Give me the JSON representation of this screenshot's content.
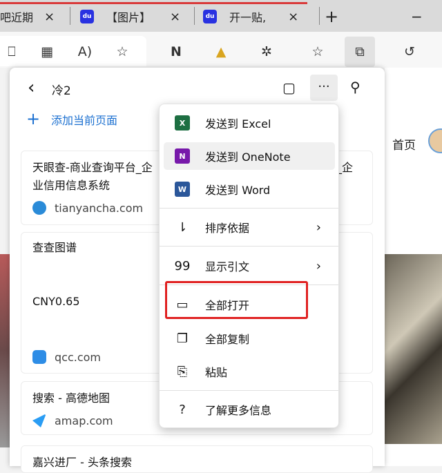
{
  "tabs": [
    {
      "label": "吧近期",
      "close": "×"
    },
    {
      "label": "【图片】",
      "close": "×"
    },
    {
      "label": "开一贴,",
      "close": "×"
    }
  ],
  "new_tab": "+",
  "minimize": "−",
  "page_behind": {
    "home_label": "首页",
    "snippet": "CNY0.65"
  },
  "panel": {
    "back": "‹",
    "title": "冷2",
    "add_label": "添加当前页面",
    "cards": [
      {
        "title_line1": "天眼查-商业查询平台_企",
        "title_tail": "_企",
        "title_line2": "业信用信息系统",
        "site": "tianyancha.com"
      },
      {
        "title": "查查图谱",
        "body": "CNY0.65",
        "site": "qcc.com"
      },
      {
        "title": "搜索 - 高德地图",
        "site": "amap.com"
      },
      {
        "title": "嘉兴进厂 - 头条搜索"
      }
    ]
  },
  "menu": {
    "items": [
      {
        "label": "发送到 Excel",
        "icon": "excel-icon",
        "badge": "X",
        "color": "#1d6f42"
      },
      {
        "label": "发送到 OneNote",
        "icon": "onenote-icon",
        "badge": "N",
        "color": "#7719aa"
      },
      {
        "label": "发送到 Word",
        "icon": "word-icon",
        "badge": "W",
        "color": "#2b579a"
      },
      {
        "label": "排序依据",
        "icon": "sort-icon",
        "glyph": "⇃≡",
        "arrow": "›"
      },
      {
        "label": "显示引文",
        "icon": "quote-icon",
        "glyph": "99",
        "arrow": "›"
      },
      {
        "label": "全部打开",
        "icon": "window-icon",
        "glyph": "▭"
      },
      {
        "label": "全部复制",
        "icon": "copy-icon",
        "glyph": "❐"
      },
      {
        "label": "粘贴",
        "icon": "paste-icon",
        "glyph": "📋"
      },
      {
        "label": "了解更多信息",
        "icon": "help-icon",
        "glyph": "?"
      }
    ]
  },
  "colors": {
    "accent": "#1a6fd0",
    "highlight_box": "#e02020"
  }
}
